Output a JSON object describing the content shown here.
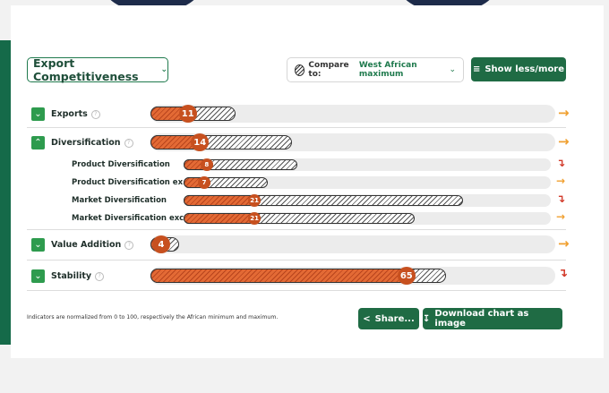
{
  "pillar_select": {
    "label": "Export Competitiveness"
  },
  "compare": {
    "label": "Compare to:",
    "value": "West African maximum"
  },
  "buttons": {
    "show_less_more": "Show less/more",
    "share": "Share...",
    "download": "Download chart as image"
  },
  "rows": [
    {
      "label": "Exports",
      "value": "11",
      "score": 11,
      "benchmark": 21,
      "trend": "up-right",
      "expanded": false
    },
    {
      "label": "Diversification",
      "value": "14",
      "score": 14,
      "benchmark": 35,
      "trend": "up-right",
      "expanded": true
    },
    {
      "label": "Value Addition",
      "value": "4",
      "score": 4,
      "benchmark": 6,
      "trend": "up-right",
      "expanded": false
    },
    {
      "label": "Stability",
      "value": "65",
      "score": 65,
      "benchmark": 73,
      "trend": "down",
      "expanded": false
    }
  ],
  "subrows": [
    {
      "label": "Product Diversification",
      "value": "8",
      "score": 8,
      "benchmark": 31,
      "trend": "down"
    },
    {
      "label": "Product Diversification ex...",
      "value": "7",
      "score": 7,
      "benchmark": 23,
      "trend": "up-right"
    },
    {
      "label": "Market Diversification",
      "value": "21",
      "score": 21,
      "benchmark": 76,
      "trend": "down"
    },
    {
      "label": "Market Diversification exc...",
      "value": "21",
      "score": 21,
      "benchmark": 63,
      "trend": "up-right"
    }
  ],
  "footnote": "Indicators are normalized from 0 to 100, respectively the African minimum and maximum.",
  "colors": {
    "accent_green": "#1f6b44",
    "bar_orange": "#c7501f",
    "trend_up": "#f0a030",
    "trend_down": "#d23a2a"
  },
  "icons": {
    "check": "chevron-down-icon",
    "info": "info-icon",
    "share": "share-icon",
    "download": "download-icon",
    "filter": "sliders-icon"
  }
}
